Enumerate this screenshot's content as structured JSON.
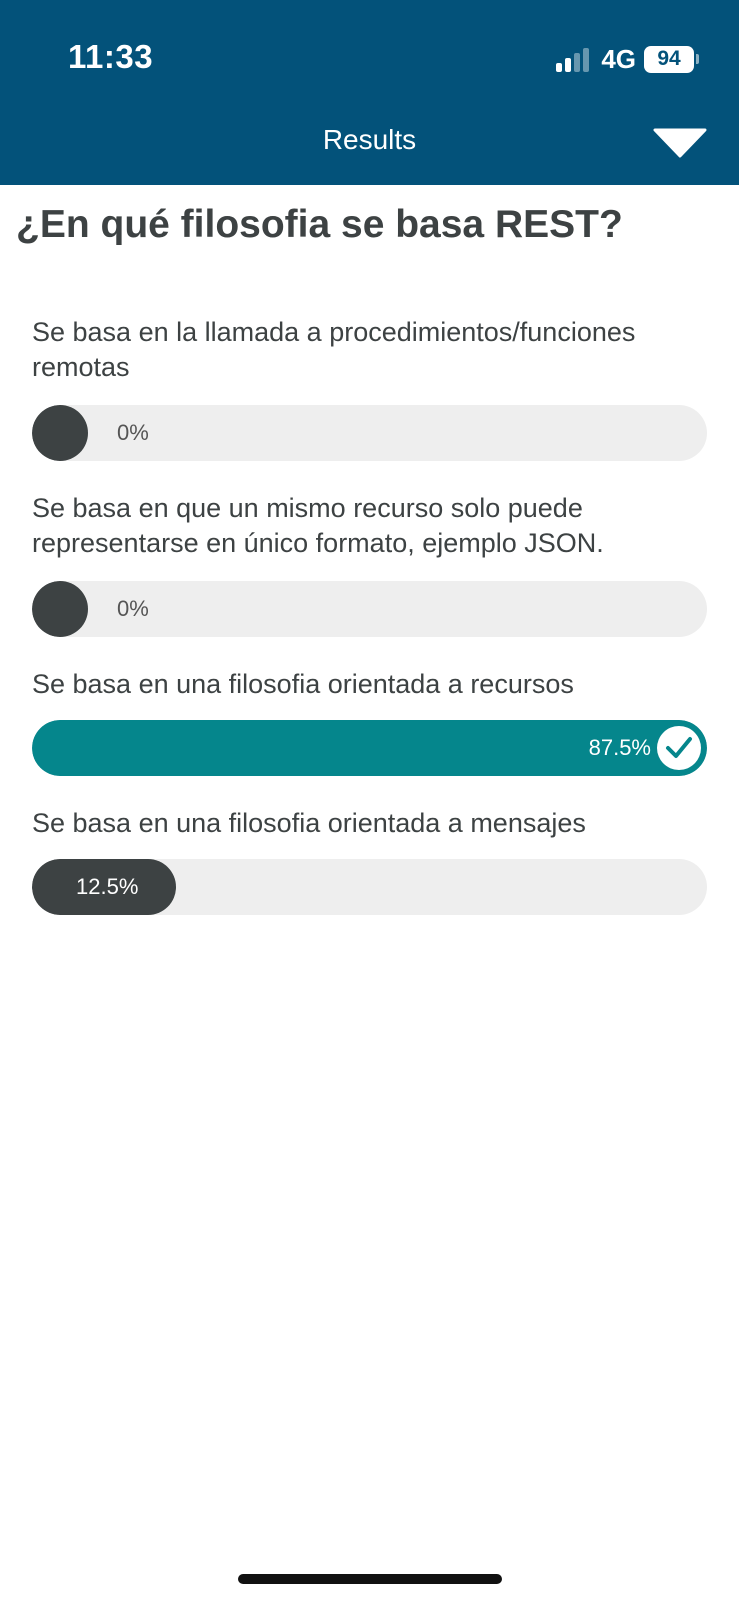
{
  "status": {
    "time": "11:33",
    "network": "4G",
    "battery": "94",
    "signal_bars_active": 2,
    "signal_bars_total": 4
  },
  "header": {
    "title": "Results",
    "collapse_icon": "triangle-down-icon"
  },
  "question": "¿En qué filosofia se basa REST?",
  "options": [
    {
      "label": "Se basa en la llamada a procedimientos/funciones remotas",
      "percent_label": "0%",
      "percent": 0,
      "correct": false
    },
    {
      "label": "Se basa en que un mismo recurso solo puede representarse en único formato, ejemplo JSON.",
      "percent_label": "0%",
      "percent": 0,
      "correct": false
    },
    {
      "label": "Se basa en una filosofia orientada a recursos",
      "percent_label": "87.5%",
      "percent": 87.5,
      "correct": true
    },
    {
      "label": "Se basa en una filosofia orientada a mensajes",
      "percent_label": "12.5%",
      "percent": 12.5,
      "correct": false
    }
  ],
  "colors": {
    "header_bg": "#03527a",
    "correct_fill": "#05868c",
    "fill": "#3d4243",
    "track": "#eeeeee"
  }
}
